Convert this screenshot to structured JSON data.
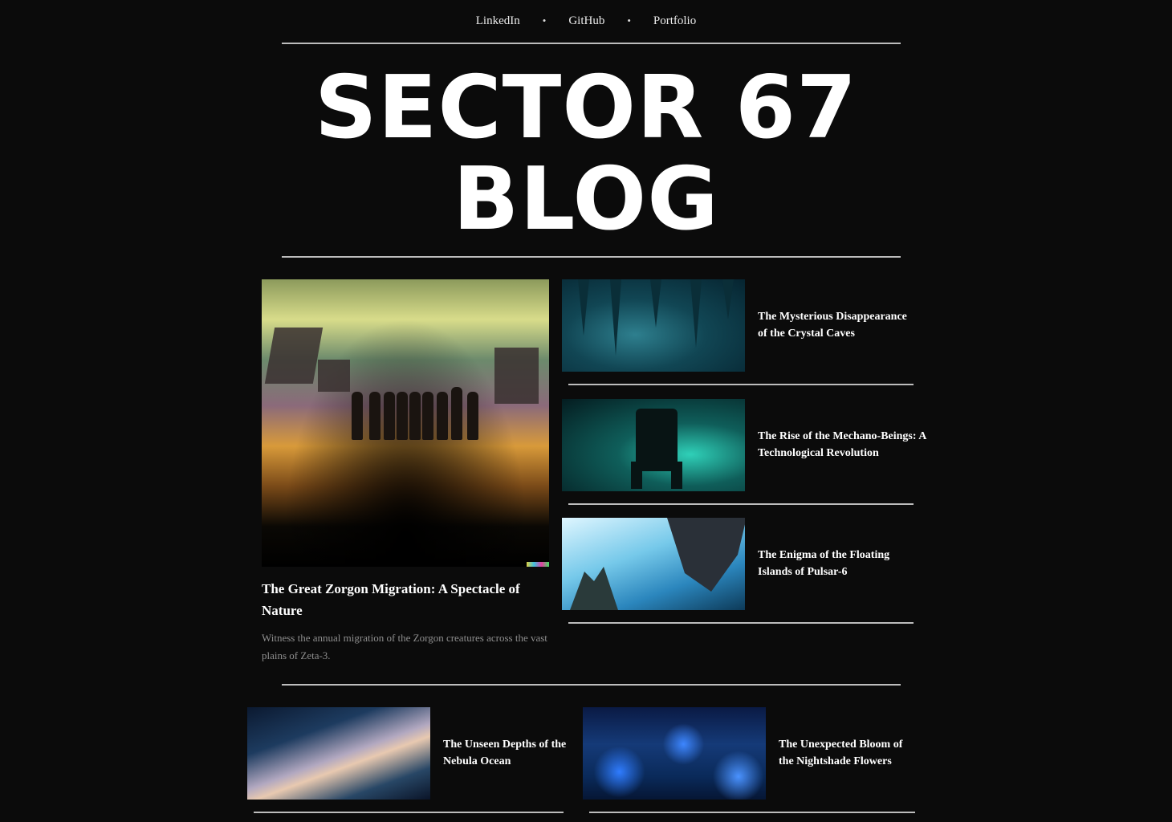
{
  "nav": {
    "links": [
      "LinkedIn",
      "GitHub",
      "Portfolio"
    ],
    "separator": "•"
  },
  "site": {
    "title_line1": "SECTOR 67",
    "title_line2": "BLOG"
  },
  "featured": {
    "title": "The Great Zorgon Migration: A Spectacle of Nature",
    "description": "Witness the annual migration of the Zorgon creatures across the vast plains of Zeta-3."
  },
  "side_posts": [
    {
      "title": "The Mysterious Disappearance of the Crystal Caves"
    },
    {
      "title": "The Rise of the Mechano-Beings: A Technological Revolution"
    },
    {
      "title": "The Enigma of the Floating Islands of Pulsar-6"
    }
  ],
  "bottom_posts": [
    {
      "title": "The Unseen Depths of the Nebula Ocean"
    },
    {
      "title": "The Unexpected Bloom of the Nightshade Flowers"
    }
  ],
  "colors": {
    "background": "#0b0b0b",
    "text": "#ffffff",
    "muted": "#8e8e8e",
    "rule": "#bdbdbd"
  }
}
